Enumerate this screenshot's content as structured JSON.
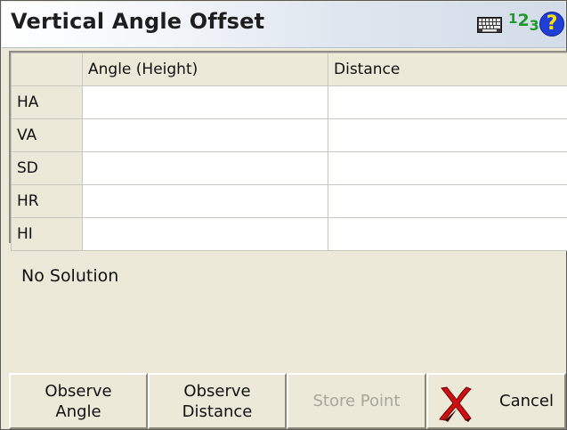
{
  "window": {
    "title": "Vertical Angle Offset",
    "icons": {
      "keyboard": "keyboard-icon",
      "input_mode": "numeric-input-icon",
      "help": "help-icon"
    },
    "input_mode_label": {
      "one": "1",
      "two": "2",
      "three": "3"
    },
    "help_glyph": "?"
  },
  "table": {
    "columns": [
      "",
      "Angle (Height)",
      "Distance"
    ],
    "rows": [
      {
        "label": "HA",
        "angle": "",
        "distance": ""
      },
      {
        "label": "VA",
        "angle": "",
        "distance": ""
      },
      {
        "label": "SD",
        "angle": "",
        "distance": ""
      },
      {
        "label": "HR",
        "angle": "",
        "distance": ""
      },
      {
        "label": "HI",
        "angle": "",
        "distance": ""
      }
    ]
  },
  "status": {
    "text": "No Solution"
  },
  "buttons": {
    "observe_angle": "Observe\nAngle",
    "observe_distance": "Observe\nDistance",
    "store_point": "Store Point",
    "cancel": "Cancel"
  },
  "colors": {
    "panel": "#ece9d8",
    "help_bg": "#1f3fd6",
    "help_fg": "#ffe300",
    "numeric_green": "#1c9a2a",
    "cancel_red": "#d01010",
    "disabled_text": "#a9a79a"
  }
}
